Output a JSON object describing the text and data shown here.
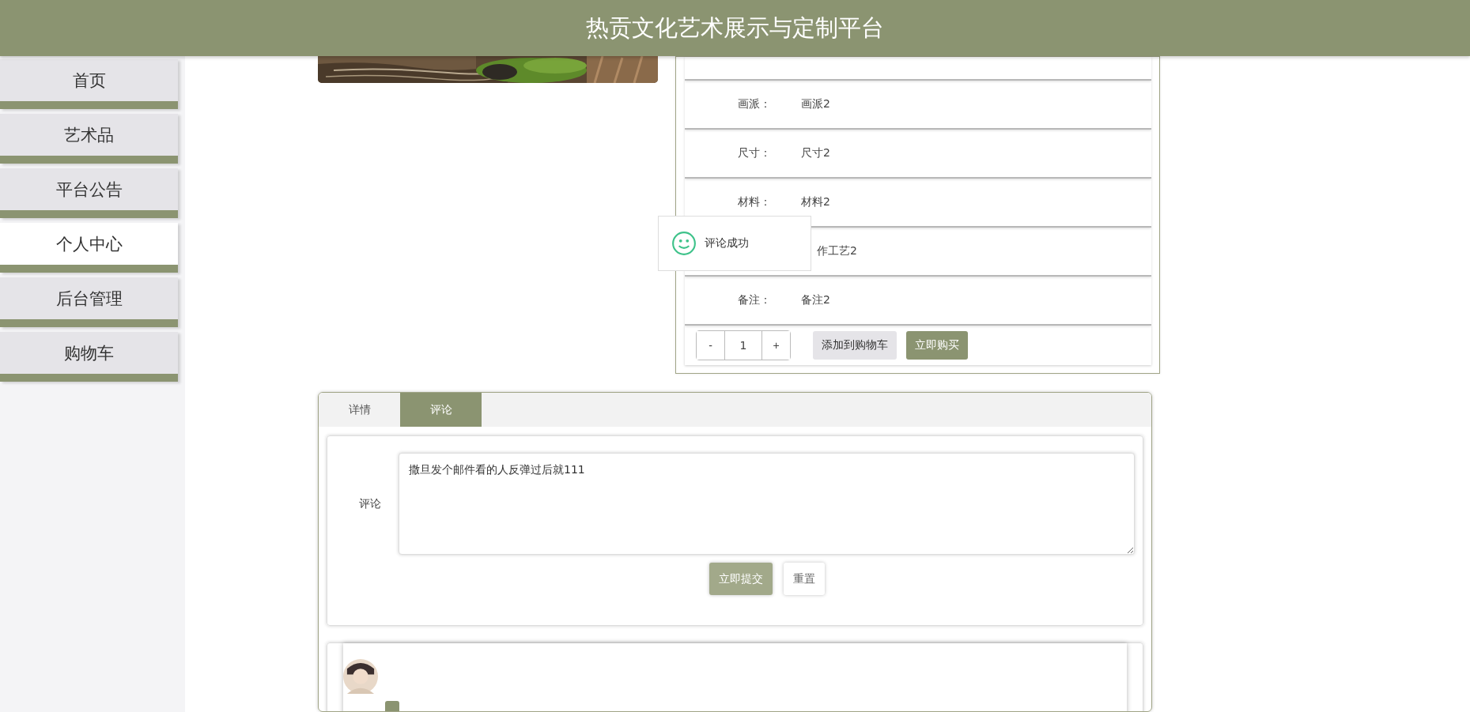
{
  "header": {
    "title": "热贡文化艺术展示与定制平台"
  },
  "sidebar": {
    "items": [
      {
        "label": "首页",
        "selected": false
      },
      {
        "label": "艺术品",
        "selected": false
      },
      {
        "label": "平台公告",
        "selected": false
      },
      {
        "label": "个人中心",
        "selected": true
      },
      {
        "label": "后台管理",
        "selected": false
      },
      {
        "label": "购物车",
        "selected": false
      }
    ]
  },
  "product": {
    "details": [
      {
        "label": "画派：",
        "value": "画派2"
      },
      {
        "label": "尺寸：",
        "value": "尺寸2"
      },
      {
        "label": "材料：",
        "value": "材料2"
      },
      {
        "value": "作工艺2"
      },
      {
        "label": "备注：",
        "value": "备注2"
      }
    ],
    "quantity": {
      "minus": "-",
      "value": "1",
      "plus": "+"
    },
    "buttons": [
      {
        "label": "添加到购物车",
        "kind": "secondary"
      },
      {
        "label": "立即购买",
        "kind": "primary"
      }
    ]
  },
  "toast": {
    "text": "评论成功"
  },
  "tabs": [
    {
      "label": "详情",
      "selected": false
    },
    {
      "label": "评论",
      "selected": true
    }
  ],
  "comment_form": {
    "label": "评论",
    "value": "撒旦发个邮件看的人反弹过后就111",
    "buttons": [
      {
        "label": "立即提交",
        "kind": "primary"
      },
      {
        "label": "重置",
        "kind": "secondary"
      }
    ]
  }
}
